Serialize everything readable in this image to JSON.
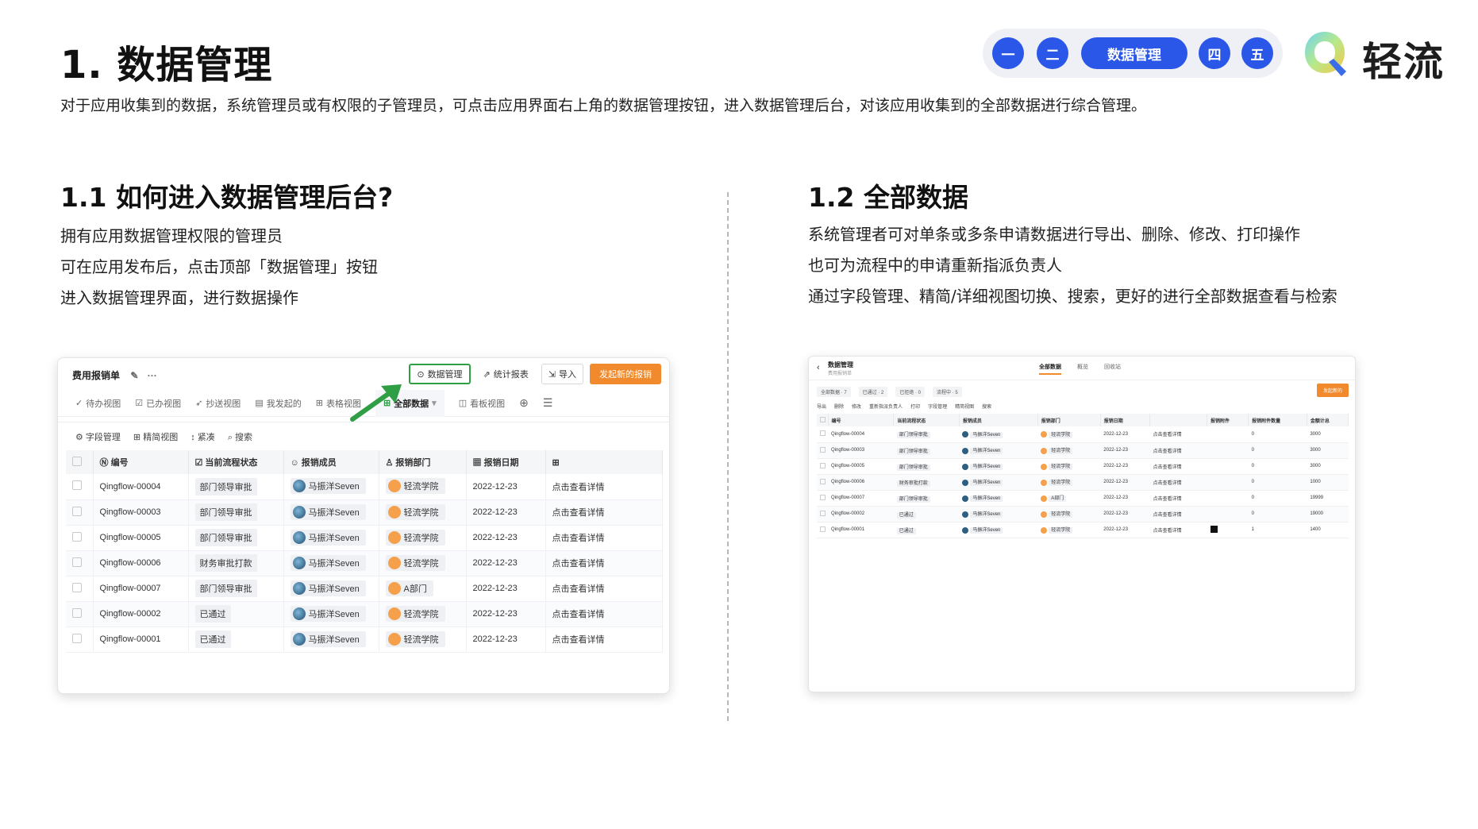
{
  "page": {
    "title": "1. 数据管理",
    "intro": "对于应用收集到的数据，系统管理员或有权限的子管理员，可点击应用界面右上角的数据管理按钮，进入数据管理后台，对该应用收集到的全部数据进行综合管理。"
  },
  "stepnav": {
    "items": [
      "一",
      "二",
      "数据管理",
      "四",
      "五"
    ],
    "active_color": "#2a57e8"
  },
  "logo": {
    "text": "轻流"
  },
  "section1": {
    "title": "1.1 如何进入数据管理后台?",
    "lines": [
      "拥有应用数据管理权限的管理员",
      "可在应用发布后，点击顶部「数据管理」按钮",
      "进入数据管理界面，进行数据操作"
    ]
  },
  "section2": {
    "title": "1.2 全部数据",
    "lines": [
      "系统管理者可对单条或多条申请数据进行导出、删除、修改、打印操作",
      "也可为流程中的申请重新指派负责人",
      "通过字段管理、精简/详细视图切换、搜索，更好的进行全部数据查看与检索"
    ]
  },
  "shot1": {
    "app_title": "费用报销单",
    "actions": {
      "data_manage": "数据管理",
      "report": "统计报表",
      "import": "导入",
      "new": "发起新的报销"
    },
    "views": [
      "待办视图",
      "已办视图",
      "抄送视图",
      "我发起的",
      "表格视图",
      "全部数据",
      "看板视图"
    ],
    "tools": [
      "字段管理",
      "精简视图",
      "紧凑",
      "搜索"
    ],
    "columns": [
      "编号",
      "当前流程状态",
      "报销成员",
      "报销部门",
      "报销日期",
      ""
    ],
    "rows": [
      [
        "Qingflow-00004",
        "部门领导审批",
        "马振洋Seven",
        "轻流学院",
        "2022-12-23",
        "点击查看详情"
      ],
      [
        "Qingflow-00003",
        "部门领导审批",
        "马振洋Seven",
        "轻流学院",
        "2022-12-23",
        "点击查看详情"
      ],
      [
        "Qingflow-00005",
        "部门领导审批",
        "马振洋Seven",
        "轻流学院",
        "2022-12-23",
        "点击查看详情"
      ],
      [
        "Qingflow-00006",
        "财务审批打款",
        "马振洋Seven",
        "轻流学院",
        "2022-12-23",
        "点击查看详情"
      ],
      [
        "Qingflow-00007",
        "部门领导审批",
        "马振洋Seven",
        "A部门",
        "2022-12-23",
        "点击查看详情"
      ],
      [
        "Qingflow-00002",
        "已通过",
        "马振洋Seven",
        "轻流学院",
        "2022-12-23",
        "点击查看详情"
      ],
      [
        "Qingflow-00001",
        "已通过",
        "马振洋Seven",
        "轻流学院",
        "2022-12-23",
        "点击查看详情"
      ]
    ]
  },
  "shot2": {
    "title": "数据管理",
    "subtitle": "费用报销单",
    "tabs": [
      "全部数据",
      "概览",
      "回收站"
    ],
    "status": [
      "全部数据 · 7",
      "已通过 · 2",
      "已拒绝 · 0",
      "流程中 · 5"
    ],
    "new_button": "发起新的",
    "tools": [
      "导出",
      "删除",
      "修改",
      "重新指派负责人",
      "打印",
      "字段管理",
      "精简视图",
      "搜索"
    ],
    "columns": [
      "编号",
      "当前流程状态",
      "报销成员",
      "报销部门",
      "报销日期",
      "",
      "报销附件",
      "报销附件数量",
      "金额计总"
    ],
    "rows": [
      [
        "Qingflow-00004",
        "部门领导审批",
        "马振洋Seven",
        "轻流学院",
        "2022-12-23",
        "点击查看详情",
        "",
        "0",
        "3000"
      ],
      [
        "Qingflow-00003",
        "部门领导审批",
        "马振洋Seven",
        "轻流学院",
        "2022-12-23",
        "点击查看详情",
        "",
        "0",
        "3000"
      ],
      [
        "Qingflow-00005",
        "部门领导审批",
        "马振洋Seven",
        "轻流学院",
        "2022-12-23",
        "点击查看详情",
        "",
        "0",
        "3000"
      ],
      [
        "Qingflow-00006",
        "财务审批打款",
        "马振洋Seven",
        "轻流学院",
        "2022-12-23",
        "点击查看详情",
        "",
        "0",
        "1000"
      ],
      [
        "Qingflow-00007",
        "部门领导审批",
        "马振洋Seven",
        "A部门",
        "2022-12-23",
        "点击查看详情",
        "",
        "0",
        "19999"
      ],
      [
        "Qingflow-00002",
        "已通过",
        "马振洋Seven",
        "轻流学院",
        "2022-12-23",
        "点击查看详情",
        "",
        "0",
        "19000"
      ],
      [
        "Qingflow-00001",
        "已通过",
        "马振洋Seven",
        "轻流学院",
        "2022-12-23",
        "点击查看详情",
        "■",
        "1",
        "1400"
      ]
    ]
  }
}
